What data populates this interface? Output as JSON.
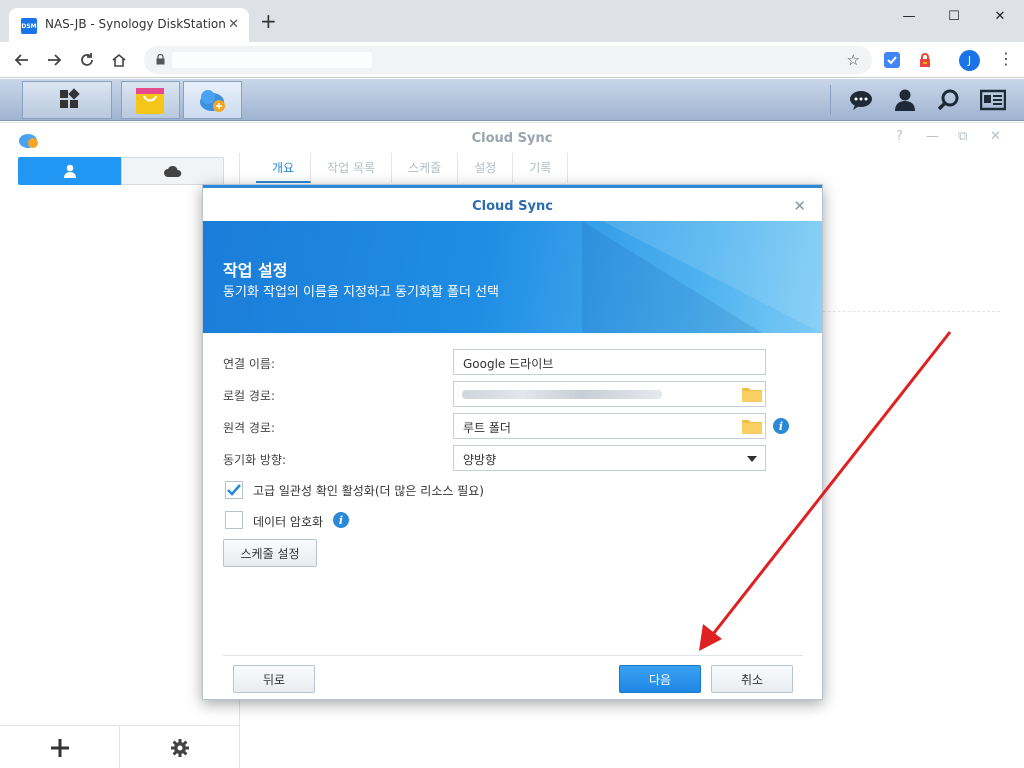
{
  "browser": {
    "tab_title": "NAS-JB - Synology DiskStation",
    "favicon_text": "DSM",
    "new_tab": "+",
    "minimize": "—",
    "maximize": "☐",
    "close": "✕",
    "avatar_initial": "J"
  },
  "app": {
    "title": "Cloud Sync",
    "tabs": [
      "개요",
      "작업 목록",
      "스케줄",
      "설정",
      "기록"
    ],
    "active_tab": 0
  },
  "modal": {
    "title": "Cloud Sync",
    "banner_title": "작업 설정",
    "banner_subtitle": "동기화 작업의 이름을 지정하고 동기화할 폴더 선택",
    "labels": {
      "connection_name": "연결 이름:",
      "local_path": "로컬 경로:",
      "remote_path": "원격 경로:",
      "sync_direction": "동기화 방향:"
    },
    "values": {
      "connection_name": "Google 드라이브",
      "remote_path": "루트 폴더",
      "sync_direction": "양방향"
    },
    "checkboxes": [
      {
        "label": "고급 일관성 확인 활성화(더 많은 리소스 필요)",
        "checked": true
      },
      {
        "label": "데이터 암호화",
        "checked": false
      }
    ],
    "schedule_button": "스케줄 설정",
    "back_button": "뒤로",
    "next_button": "다음",
    "cancel_button": "취소"
  },
  "colors": {
    "accent": "#2b8ad8",
    "arrow": "#e02020"
  }
}
